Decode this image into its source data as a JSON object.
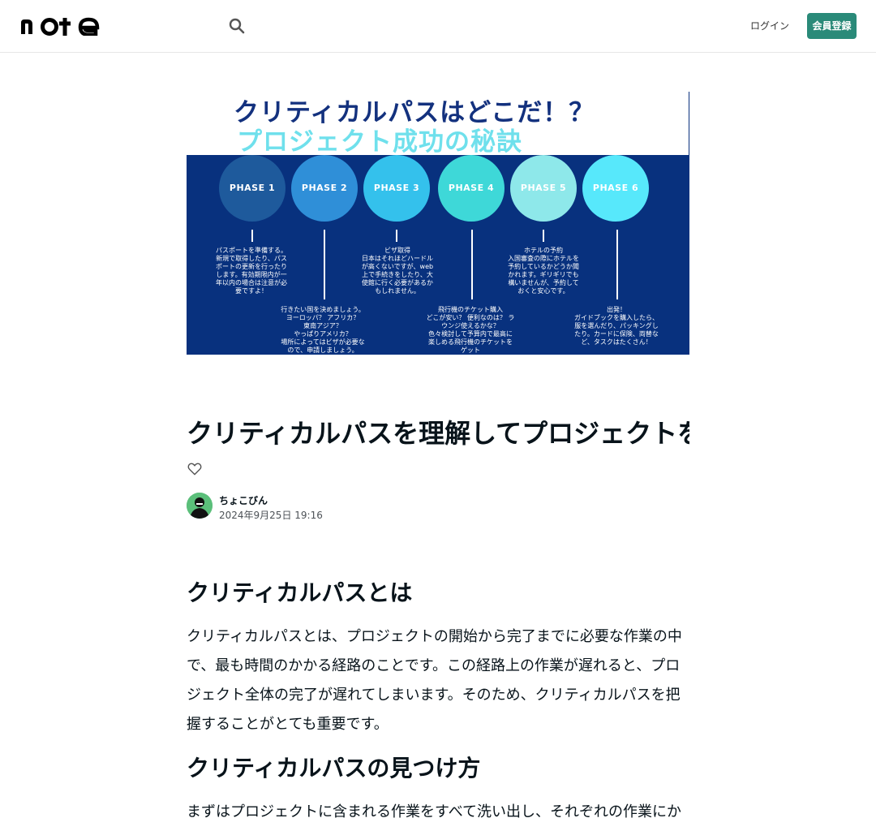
{
  "header": {
    "logo_text": "note",
    "search_icon": "search-icon",
    "login_label": "ログイン",
    "signup_label": "会員登録",
    "accent_color": "#2a8a79"
  },
  "eyecatch": {
    "title_line1": "クリティカルパスはどこだ！？",
    "title_line2": "プロジェクト成功の秘訣",
    "phases": [
      {
        "label": "PHASE 1",
        "color": "#1e5a9c"
      },
      {
        "label": "PHASE 2",
        "color": "#2f8fd8"
      },
      {
        "label": "PHASE 3",
        "color": "#34c1ec"
      },
      {
        "label": "PHASE 4",
        "color": "#3ed8d8"
      },
      {
        "label": "PHASE 5",
        "color": "#8ee8ea"
      },
      {
        "label": "PHASE 6",
        "color": "#57e8fb"
      }
    ],
    "texts_top": [
      "パスポートを準備する。\n新規で取得したり、パス\nポートの更新を行ったり\nします。有効期限内が一\n年以内の場合は注意が必\n要ですよ！",
      "ビザ取得\n日本はそれほどハードル\nが高くないですが、web\n上で手続きをしたり、大\n使館に行く必要があるか\nもしれません。",
      "ホテルの予約\n入国審査の際にホテルを\n予約しているかどうか聞\nかれます。ギリギリでも\n構いませんが、予約して\nおくと安心です。"
    ],
    "texts_bottom": [
      "行きたい国を決めましょう。\nヨーロッパ？ アフリカ？\n東南アジア？\nやっぱりアメリカ？\n場所によってはビザが必要な\nので、申請しましょう。",
      "飛行機のチケット購入\nどこが安い？ 便利なのは？ ラ\nウンジ使えるかな？\n色々検討して予算内で最高に\n楽しめる飛行機のチケットを\nゲット",
      "出発！\nガイドブックを購入したら、\n服を選んだり、パッキングし\nたり。カードに保険、両替な\nど、タスクはたくさん！"
    ]
  },
  "article": {
    "title": "クリティカルパスを理解してプロジェクトを成功させる",
    "author": "ちょこびん",
    "date": "2024年9月25日 19:16",
    "sections": [
      {
        "heading": "クリティカルパスとは",
        "body": "クリティカルパスとは、プロジェクトの開始から完了までに必要な作業の中で、最も時間のかかる経路のことです。この経路上の作業が遅れると、プロジェクト全体の完了が遅れてしまいます。そのため、クリティカルパスを把握することがとても重要です。"
      },
      {
        "heading": "クリティカルパスの見つけ方",
        "body": "まずはプロジェクトに含まれる作業をすべて洗い出し、それぞれの作業にかかる時間と作業同士の依存関係を整理します。"
      }
    ]
  }
}
